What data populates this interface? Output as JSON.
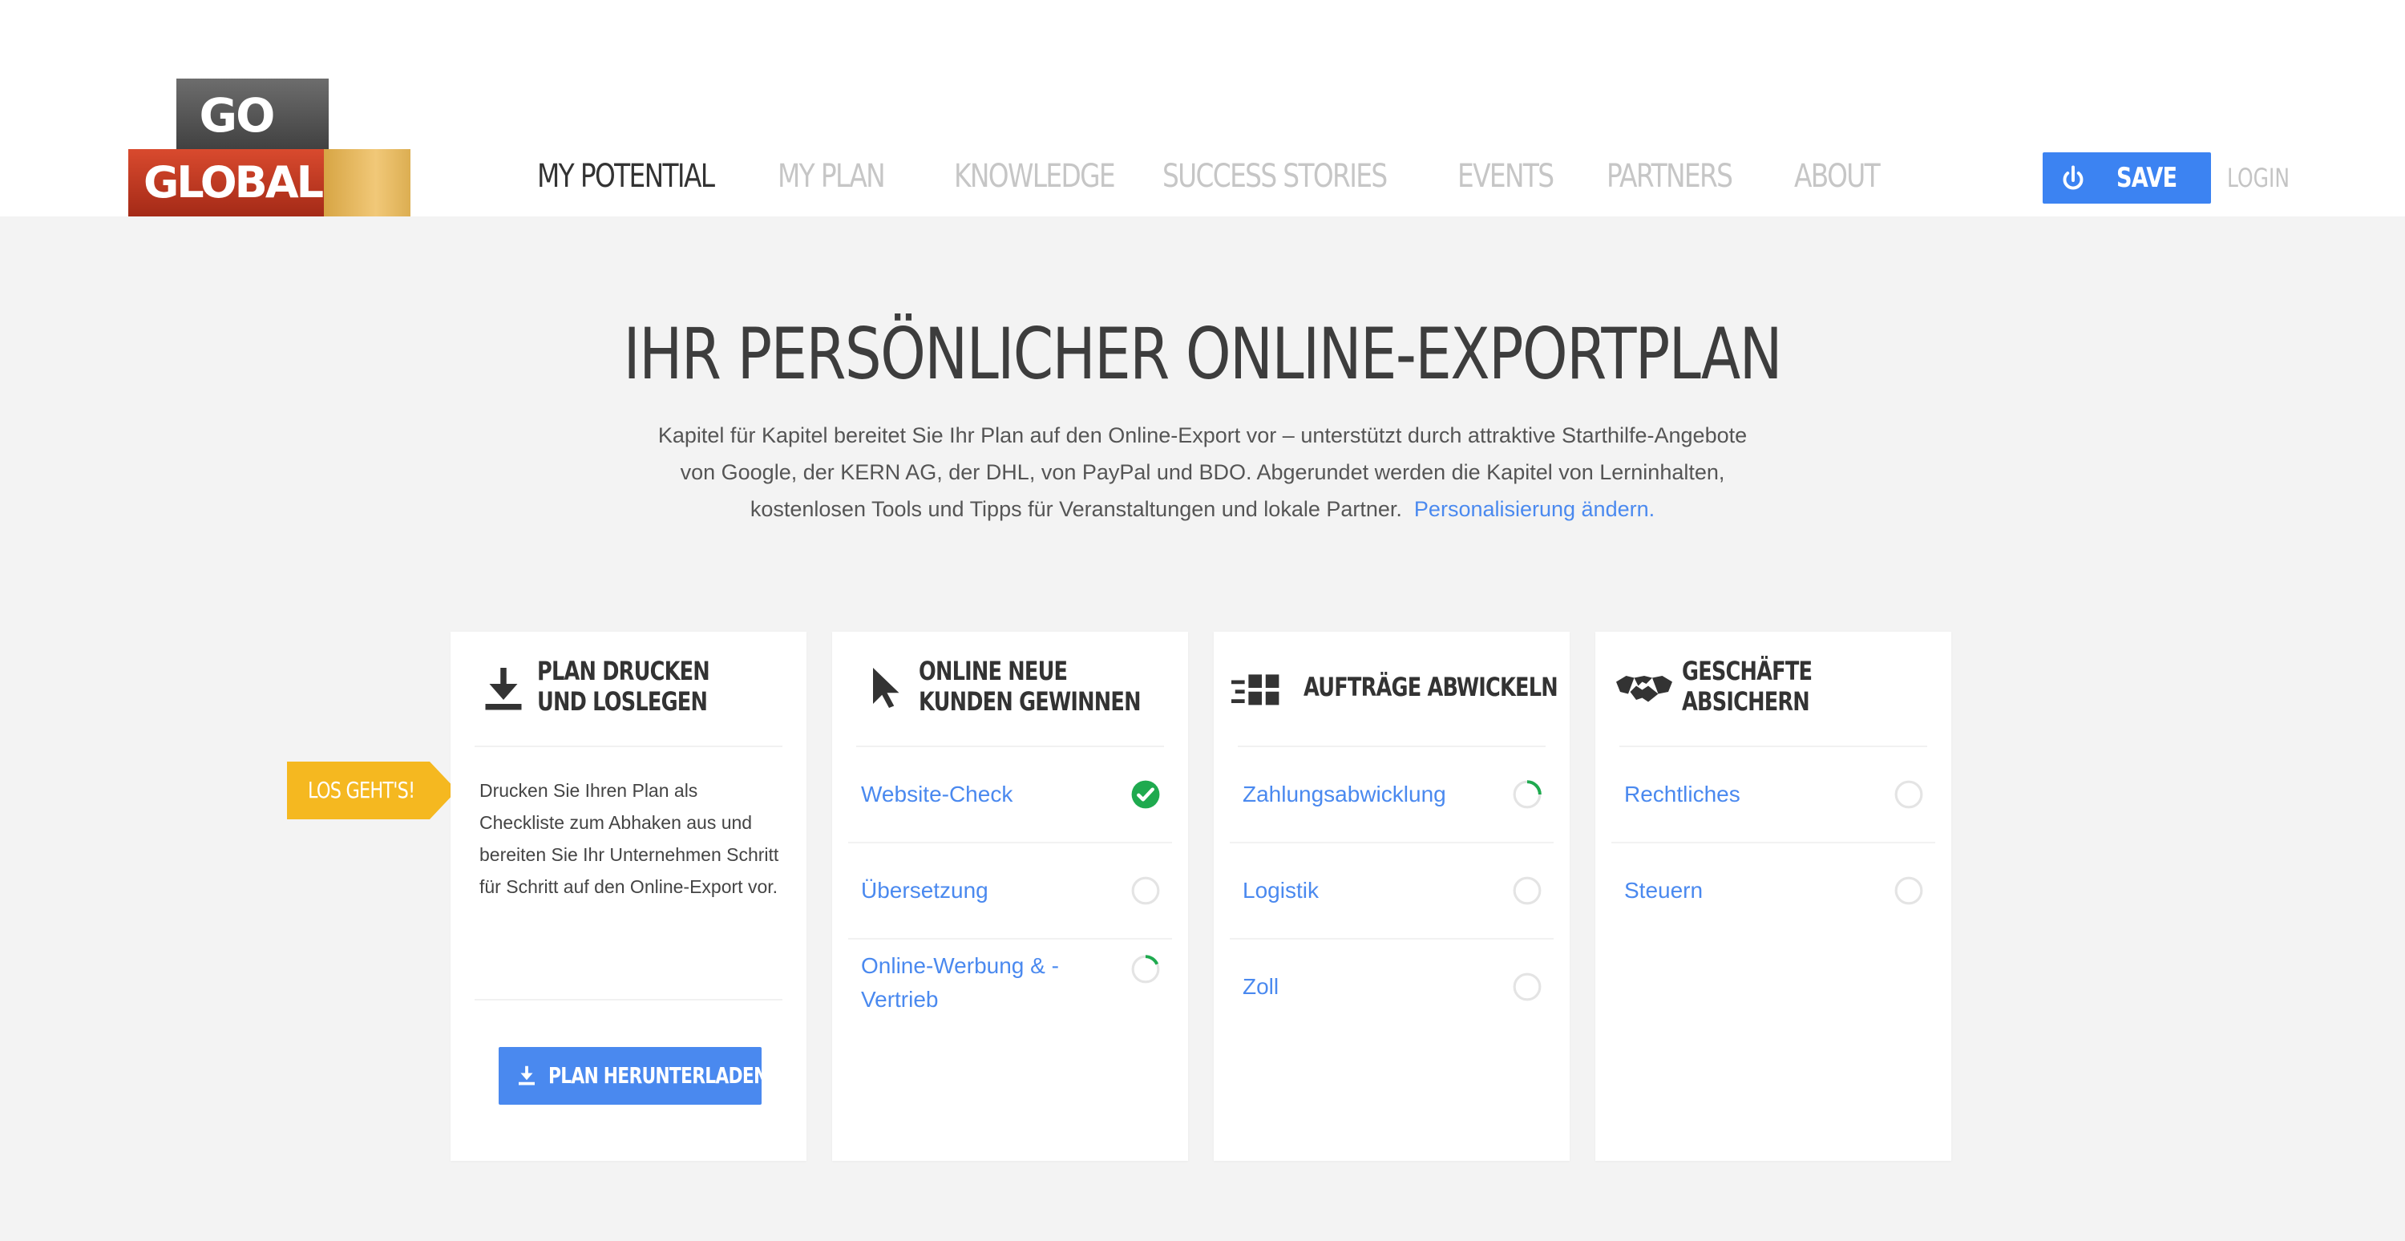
{
  "logo": {
    "line1": "GO",
    "line2": "GLOBAL"
  },
  "nav": {
    "items": [
      "MY POTENTIAL",
      "MY PLAN",
      "KNOWLEDGE",
      "SUCCESS STORIES",
      "EVENTS",
      "PARTNERS",
      "ABOUT"
    ],
    "active": "MY POTENTIAL"
  },
  "header": {
    "save_label": "SAVE",
    "login_label": "LOGIN"
  },
  "hero": {
    "title": "IHR PERSÖNLICHER ONLINE-EXPORTPLAN",
    "intro_line1": "Kapitel für Kapitel bereitet Sie Ihr Plan auf den Online-Export vor – unterstützt durch attraktive Starthilfe-Angebote",
    "intro_line2": "von Google, der KERN AG, der DHL, von PayPal und BDO. Abgerundet werden die Kapitel von Lerninhalten,",
    "intro_line3": "kostenlosen Tools und Tipps für Veranstaltungen und lokale Partner.",
    "intro_link": "Personalisierung ändern."
  },
  "tag": {
    "label": "LOS GEHT'S!",
    "color": "#f5b820"
  },
  "cards": [
    {
      "icon": "download-icon",
      "title_line1": "PLAN DRUCKEN",
      "title_line2": "UND LOSLEGEN",
      "text": "Drucken Sie Ihren Plan als Checkliste zum Abhaken aus und bereiten Sie Ihr Unternehmen Schritt für Schritt auf den Online-Export vor.",
      "button_label": "PLAN HERUNTERLADEN"
    },
    {
      "icon": "cursor-icon",
      "title_line1": "ONLINE NEUE",
      "title_line2": "KUNDEN GEWINNEN",
      "tasks": [
        {
          "label": "Website-Check",
          "status": "done"
        },
        {
          "label": "Übersetzung",
          "status": "open"
        },
        {
          "label": "Online-Werbung & -Vertrieb",
          "status": "in-progress"
        }
      ]
    },
    {
      "icon": "fast-boxes-icon",
      "title_line1": "AUFTRÄGE ABWICKELN",
      "tasks": [
        {
          "label": "Zahlungsabwicklung",
          "status": "in-progress"
        },
        {
          "label": "Logistik",
          "status": "open"
        },
        {
          "label": "Zoll",
          "status": "open"
        }
      ]
    },
    {
      "icon": "handshake-icon",
      "title_line1": "GESCHÄFTE",
      "title_line2": "ABSICHERN",
      "tasks": [
        {
          "label": "Rechtliches",
          "status": "open"
        },
        {
          "label": "Steuern",
          "status": "open"
        }
      ]
    }
  ],
  "colors": {
    "accent": "#4a89ef",
    "done": "#1faa4f",
    "tag": "#f5b820",
    "logo_red": "#c0392b"
  }
}
